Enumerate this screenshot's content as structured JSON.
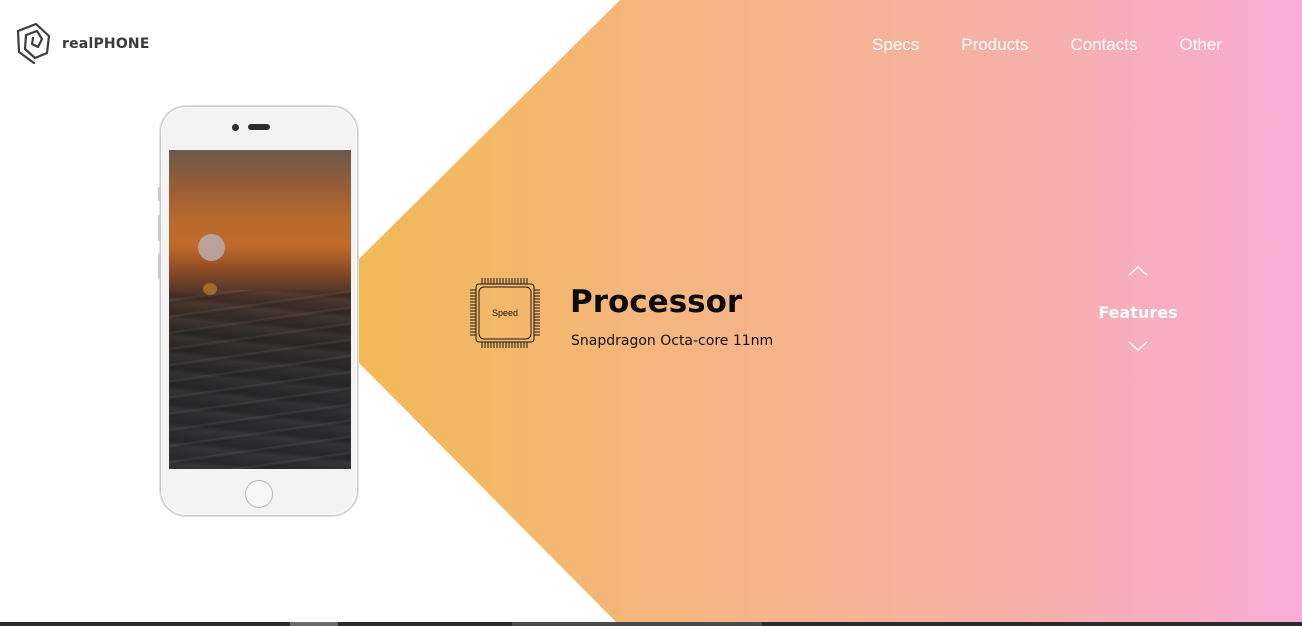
{
  "brand": {
    "name": "realPHONE",
    "logo_icon": "spiral-pentagon-icon"
  },
  "nav": {
    "items": [
      {
        "label": "Specs"
      },
      {
        "label": "Products"
      },
      {
        "label": "Contacts"
      },
      {
        "label": "Other"
      }
    ]
  },
  "hero": {
    "phone_screen": "sunset-over-ocean-wallpaper",
    "feature": {
      "icon": "processor-chip-icon",
      "icon_label": "Speed",
      "title": "Processor",
      "description": "Snapdragon Octa-core 11nm"
    },
    "selector": {
      "label": "Features",
      "up_icon": "chevron-up-icon",
      "down_icon": "chevron-down-icon"
    }
  },
  "colors": {
    "gradient_start": "#f2b957",
    "gradient_end": "#f8abd6",
    "text_dark": "#0b0b0b",
    "text_light": "#ffffff"
  }
}
